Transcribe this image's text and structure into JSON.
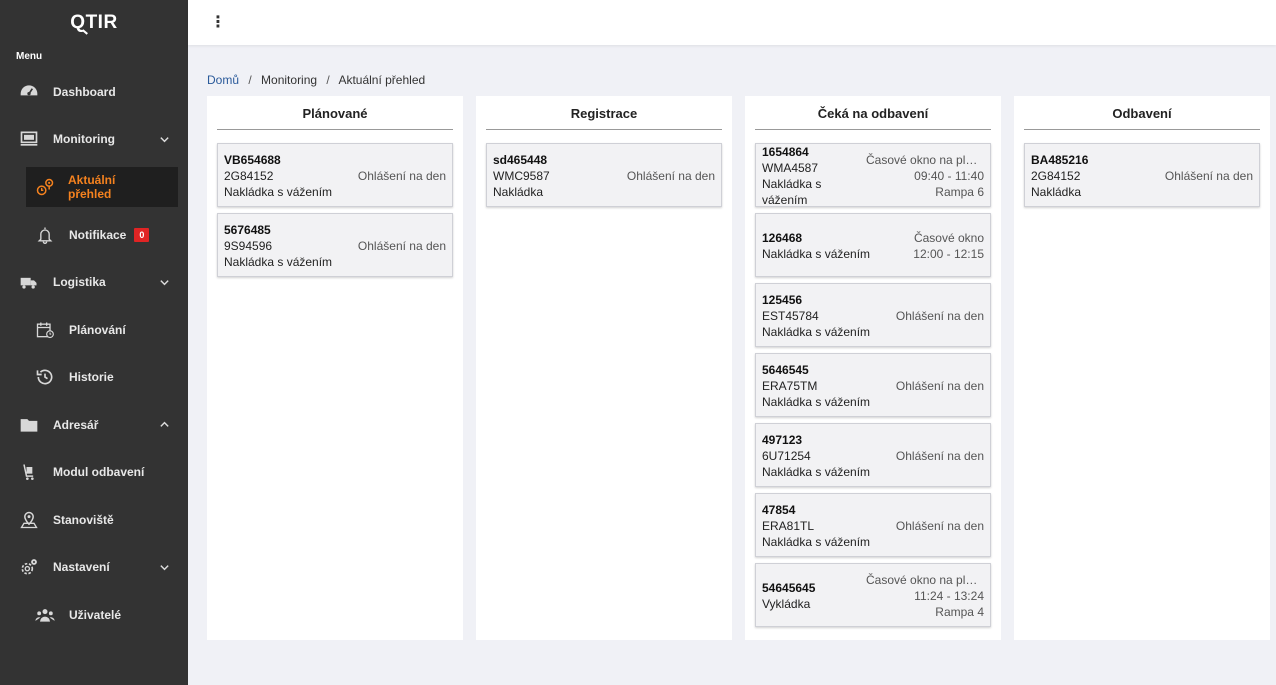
{
  "app": {
    "logo": "QTIR",
    "logo_q": "Q",
    "logo_rest": "TIR"
  },
  "sidebar": {
    "menu_label": "Menu",
    "items": [
      {
        "label": "Dashboard",
        "icon": "dashboard-icon"
      },
      {
        "label": "Monitoring",
        "icon": "monitor-icon",
        "expanded": true
      },
      {
        "label": "Aktuální přehled",
        "icon": "tracking-icon",
        "active": true
      },
      {
        "label": "Notifikace",
        "icon": "bell-icon",
        "badge": "0"
      },
      {
        "label": "Logistika",
        "icon": "truck-icon"
      },
      {
        "label": "Plánování",
        "icon": "calendar-icon"
      },
      {
        "label": "Historie",
        "icon": "history-icon"
      },
      {
        "label": "Adresář",
        "icon": "folder-icon"
      },
      {
        "label": "Modul odbavení",
        "icon": "cart-icon"
      },
      {
        "label": "Stanoviště",
        "icon": "location-icon"
      },
      {
        "label": "Nastavení",
        "icon": "gear-icon"
      },
      {
        "label": "Uživatelé",
        "icon": "users-icon"
      }
    ]
  },
  "topbar": {
    "menu_icon": "kebab-icon"
  },
  "breadcrumb": {
    "home": "Domů",
    "sep": "/",
    "level1": "Monitoring",
    "level2": "Aktuální přehled"
  },
  "columns": [
    {
      "title": "Plánované",
      "cards": [
        {
          "id": "VB654688",
          "plate": "2G84152",
          "type": "Nakládka s vážením",
          "status": "Ohlášení na den"
        },
        {
          "id": "5676485",
          "plate": "9S94596",
          "type": "Nakládka s vážením",
          "status": "Ohlášení na den"
        }
      ]
    },
    {
      "title": "Registrace",
      "cards": [
        {
          "id": "sd465448",
          "plate": "WMC9587",
          "type": "Nakládka",
          "status": "Ohlášení na den"
        }
      ]
    },
    {
      "title": "Čeká na odbavení",
      "cards": [
        {
          "id": "1654864",
          "plate": "WMA4587",
          "type": "Nakládka s vážením",
          "status": "Časové okno na platnost",
          "time": "09:40 - 11:40",
          "ramp": "Rampa 6"
        },
        {
          "id": "126468",
          "type": "Nakládka s vážením",
          "status": "Časové okno",
          "time": "12:00 - 12:15"
        },
        {
          "id": "125456",
          "plate": "EST45784",
          "type": "Nakládka s vážením",
          "status": "Ohlášení na den"
        },
        {
          "id": "5646545",
          "plate": "ERA75TM",
          "type": "Nakládka s vážením",
          "status": "Ohlášení na den"
        },
        {
          "id": "497123",
          "plate": "6U71254",
          "type": "Nakládka s vážením",
          "status": "Ohlášení na den"
        },
        {
          "id": "47854",
          "plate": "ERA81TL",
          "type": "Nakládka s vážením",
          "status": "Ohlášení na den"
        },
        {
          "id": "54645645",
          "type": "Vykládka",
          "status": "Časové okno na platnost",
          "time": "11:24 - 13:24",
          "ramp": "Rampa 4"
        }
      ]
    },
    {
      "title": "Odbavení",
      "cards": [
        {
          "id": "BA485216",
          "plate": "2G84152",
          "type": "Nakládka",
          "status": "Ohlášení na den"
        }
      ]
    }
  ]
}
